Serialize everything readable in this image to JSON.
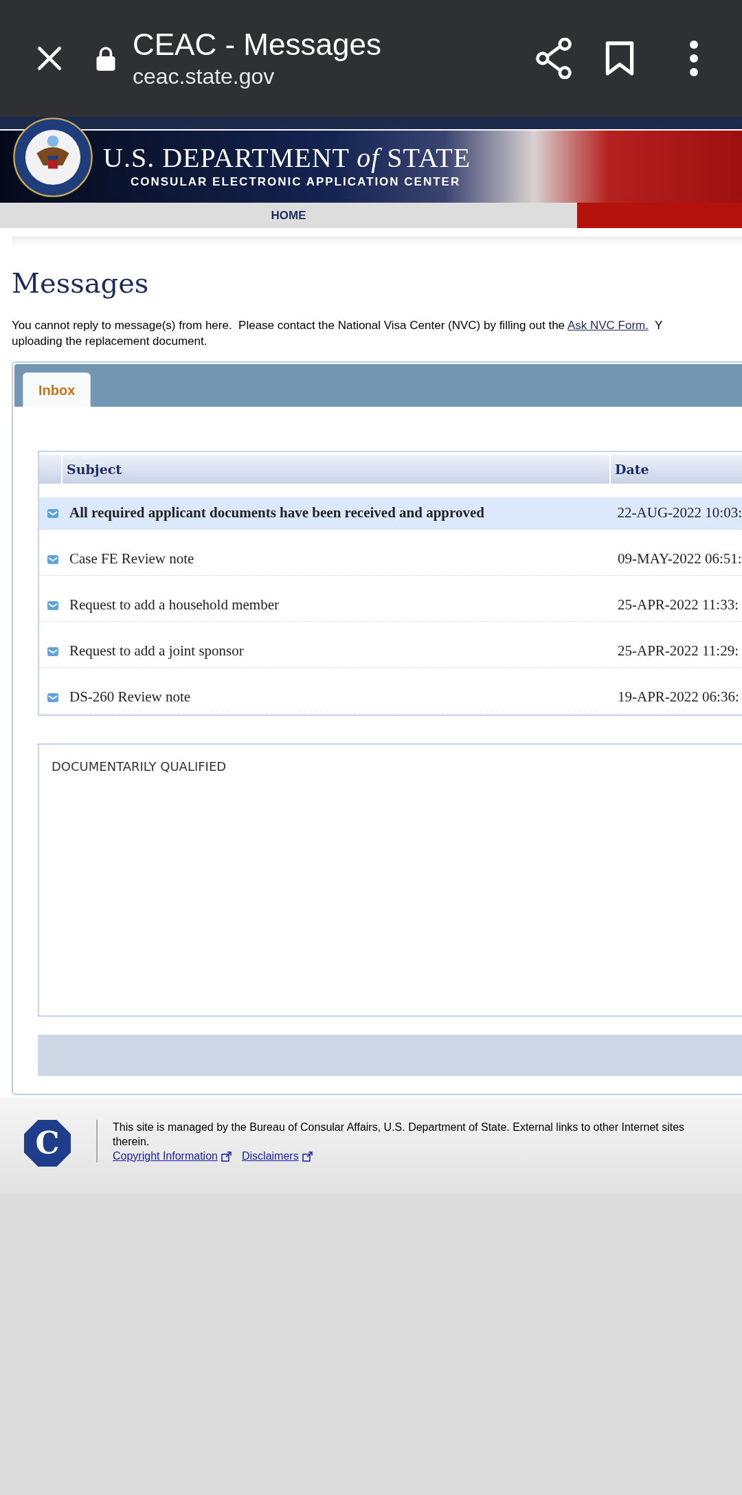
{
  "browser": {
    "title": "CEAC - Messages",
    "url": "ceac.state.gov"
  },
  "banner": {
    "title": "U.S. DEPARTMENT *of* STATE",
    "subtitle": "CONSULAR ELECTRONIC APPLICATION CENTER"
  },
  "nav": {
    "items": [
      "HOME"
    ]
  },
  "heading": "Messages",
  "notice": {
    "before": "You cannot reply to message(s) from here.  Please contact the National Visa Center (NVC) by filling out the",
    "link": "Ask NVC Form.",
    "after": "Y",
    "line_2": "uploading the replacement document."
  },
  "tabs": [
    {
      "label": "Inbox",
      "selected": true
    }
  ],
  "table": {
    "columns": [
      "Subject",
      "Date"
    ],
    "rows": [
      {
        "subject": "All required applicant documents have been received and approved",
        "date": "22-AUG-2022 10:03:",
        "selected": true,
        "unread": true
      },
      {
        "subject": "Case FE Review note",
        "date": "09-MAY-2022 06:51:",
        "selected": false,
        "unread": false
      },
      {
        "subject": "Request to add a household member",
        "date": "25-APR-2022 11:33:",
        "selected": false,
        "unread": false
      },
      {
        "subject": "Request to add a joint sponsor",
        "date": "25-APR-2022 11:29:",
        "selected": false,
        "unread": false
      },
      {
        "subject": "DS-260 Review note",
        "date": "19-APR-2022 06:36:",
        "selected": false,
        "unread": false
      }
    ]
  },
  "message_body": "DOCUMENTARILY QUALIFIED",
  "footer": {
    "logo": "C",
    "lines": [
      "This site is managed by the Bureau of Consular Affairs, U.S. Department of State. External links to other Internet sites",
      "therein."
    ],
    "links": [
      "Copyright Information",
      "Disclaimers"
    ]
  }
}
